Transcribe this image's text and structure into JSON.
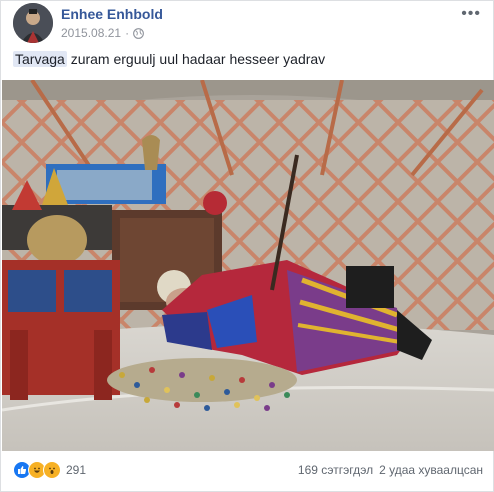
{
  "post": {
    "author": "Enhee Enhbold",
    "date": "2015.08.21",
    "privacy_icon": "globe-icon",
    "more_label": "•••",
    "text_tag": "Tarvaga",
    "text_rest": " zuram erguulj uul hadaar hesseer yadrav"
  },
  "footer": {
    "reaction_icons": [
      "like-icon",
      "haha-icon",
      "wow-icon"
    ],
    "reaction_count": "291",
    "comments": "169 сэтгэгдэл",
    "shares": "2 удаа хуваалцсан"
  },
  "colors": {
    "author": "#365899",
    "meta": "#90949c",
    "like": "#1877f2",
    "emoji": "#f7b125",
    "tag_bg": "#e1e7f4"
  }
}
